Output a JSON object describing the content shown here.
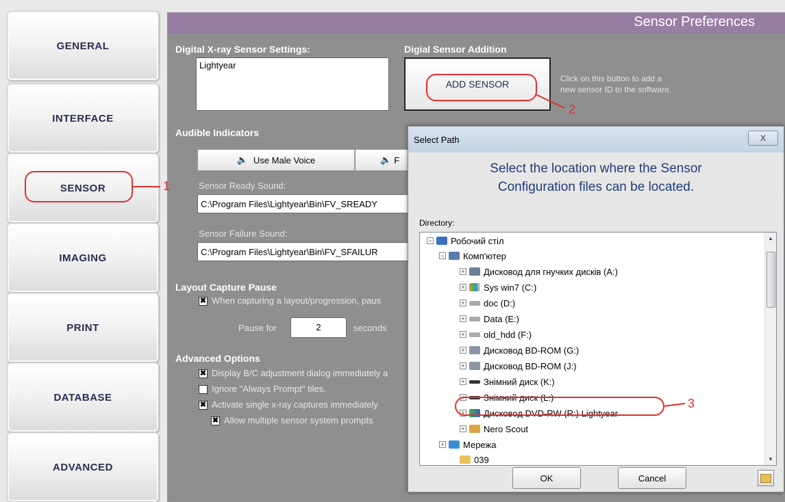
{
  "nav": {
    "general": "GENERAL",
    "interface": "INTERFACE",
    "sensor": "SENSOR",
    "imaging": "IMAGING",
    "print": "PRINT",
    "database": "DATABASE",
    "advanced": "ADVANCED"
  },
  "header": {
    "title": "Sensor Preferences"
  },
  "sensor_settings": {
    "label": "Digital X-ray Sensor Settings:",
    "list_items": [
      "Lightyear"
    ]
  },
  "sensor_addition": {
    "label": "Digial Sensor Addition",
    "button": "ADD SENSOR",
    "hint_line1": "Click on this button to add a",
    "hint_line2": "new sensor ID to the software."
  },
  "audible": {
    "label": "Audible Indicators",
    "male_voice": "Use Male Voice",
    "female_voice_partial": "F",
    "ready_label": "Sensor Ready Sound:",
    "ready_path": "C:\\Program Files\\Lightyear\\Bin\\FV_SREADY",
    "failure_label": "Sensor Failure Sound:",
    "failure_path": "C:\\Program Files\\Lightyear\\Bin\\FV_SFAILUR"
  },
  "layout_pause": {
    "label": "Layout Capture Pause",
    "option": "When capturing a layout/progression, paus",
    "pause_for": "Pause for",
    "value": "2",
    "seconds": "seconds"
  },
  "advanced_options": {
    "label": "Advanced Options",
    "opt1": "Display B/C adjustment dialog immediately a",
    "opt2": "Ignore \"Always Prompt\" tiles.",
    "opt3": "Activate single x-ray captures immediately",
    "opt4": "Allow multiple sensor system prompts"
  },
  "dialog": {
    "title": "Select Path",
    "close": "X",
    "heading_line1": "Select the location where the Sensor",
    "heading_line2": "Configuration files can be located.",
    "directory_label": "Directory:",
    "tree": [
      {
        "label": "Робочий стіл",
        "icon": "desktop-icon"
      },
      {
        "label": "Комп'ютер",
        "icon": "computer-icon"
      },
      {
        "label": "Дисковод для гнучких дисків (A:)",
        "icon": "floppy-icon"
      },
      {
        "label": "Sys win7 (C:)",
        "icon": "system-drive-icon"
      },
      {
        "label": "doc (D:)",
        "icon": "drive-icon"
      },
      {
        "label": "Data (E:)",
        "icon": "drive-icon"
      },
      {
        "label": "old_hdd (F:)",
        "icon": "drive-icon"
      },
      {
        "label": "Дисковод BD-ROM (G:)",
        "icon": "bd-rom-icon"
      },
      {
        "label": "Дисковод BD-ROM (J:)",
        "icon": "bd-rom-icon"
      },
      {
        "label": "Знімний диск (K:)",
        "icon": "removable-drive-icon"
      },
      {
        "label": "Знімний диск (L:)",
        "icon": "removable-drive-icon"
      },
      {
        "label": "Дисковод DVD-RW (R:) Lightyear",
        "icon": "dvd-rw-icon"
      },
      {
        "label": "Nero Scout",
        "icon": "nero-scout-icon"
      },
      {
        "label": "Мережа",
        "icon": "network-icon"
      },
      {
        "label": "039",
        "icon": "folder-icon"
      }
    ],
    "ok": "OK",
    "cancel": "Cancel"
  },
  "callouts": {
    "one": "1",
    "two": "2",
    "three": "3"
  },
  "colors": {
    "title_bar": "#9b7fa6",
    "panel": "#8c8c8c",
    "callout": "#e03030",
    "nav_text": "#2a2d52"
  }
}
